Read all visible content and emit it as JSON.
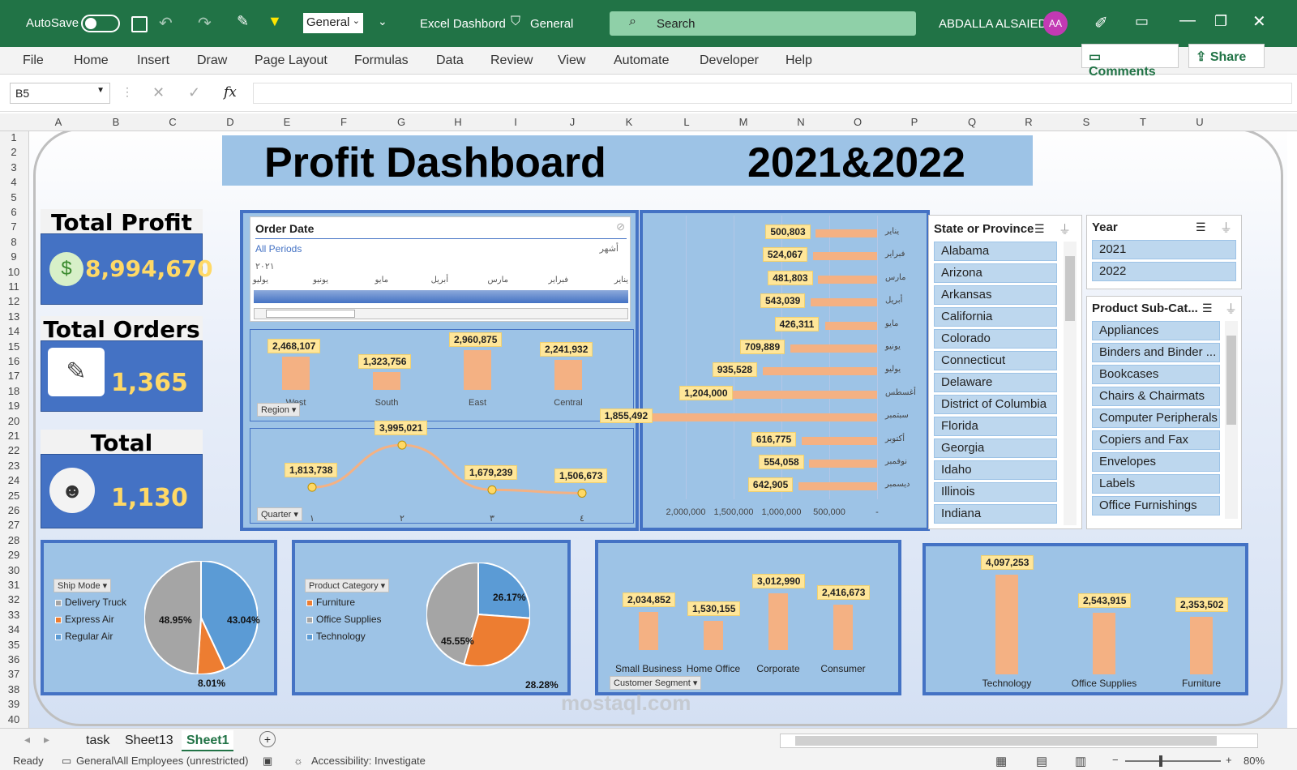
{
  "titlebar": {
    "autosave": "AutoSave",
    "format_value": "General",
    "doc_title": "Excel Dashbord",
    "sensitivity": "General",
    "search_placeholder": "Search",
    "user_name": "ABDALLA ALSAIED",
    "user_initials": "AA"
  },
  "ribbon": {
    "tabs": [
      "File",
      "Home",
      "Insert",
      "Draw",
      "Page Layout",
      "Formulas",
      "Data",
      "Review",
      "View",
      "Automate",
      "Developer",
      "Help"
    ],
    "comments": "Comments",
    "share": "Share"
  },
  "formula_bar": {
    "name_box": "B5",
    "fx": "fx"
  },
  "columns": [
    "A",
    "B",
    "C",
    "D",
    "E",
    "F",
    "G",
    "H",
    "I",
    "J",
    "K",
    "L",
    "M",
    "N",
    "O",
    "P",
    "Q",
    "R",
    "S",
    "T",
    "U"
  ],
  "rows": [
    "1",
    "2",
    "3",
    "4",
    "5",
    "6",
    "7",
    "8",
    "9",
    "10",
    "11",
    "12",
    "13",
    "14",
    "15",
    "16",
    "17",
    "18",
    "19",
    "20",
    "21",
    "22",
    "23",
    "24",
    "25",
    "26",
    "27",
    "28",
    "29",
    "30",
    "31",
    "32",
    "33",
    "34",
    "35",
    "36",
    "37",
    "38",
    "39",
    "40"
  ],
  "dashboard": {
    "title": "Profit Dashboard",
    "years": "2021&2022",
    "kpis": [
      {
        "title": "Total Profit",
        "value": "8,994,670",
        "icon": "money-bag-icon"
      },
      {
        "title": "Total Orders",
        "value": "1,365",
        "icon": "orders-icon"
      },
      {
        "title": "Total Customer",
        "value": "1,130",
        "icon": "customers-icon"
      }
    ],
    "timeline": {
      "title": "Order Date",
      "period": "All Periods",
      "unit": "أشهر",
      "year": "٢٠٢١",
      "months": [
        "يناير",
        "فبراير",
        "مارس",
        "أبريل",
        "مايو",
        "يونيو",
        "يوليو"
      ]
    },
    "state_slicer": {
      "title": "State or Province",
      "items": [
        "Alabama",
        "Arizona",
        "Arkansas",
        "California",
        "Colorado",
        "Connecticut",
        "Delaware",
        "District of Columbia",
        "Florida",
        "Georgia",
        "Idaho",
        "Illinois",
        "Indiana"
      ]
    },
    "year_slicer": {
      "title": "Year",
      "items": [
        "2021",
        "2022"
      ]
    },
    "subcat_slicer": {
      "title": "Product Sub-Cat...",
      "items": [
        "Appliances",
        "Binders and Binder ...",
        "Bookcases",
        "Chairs & Chairmats",
        "Computer Peripherals",
        "Copiers and Fax",
        "Envelopes",
        "Labels",
        "Office Furnishings"
      ]
    },
    "region_filter": "Region",
    "quarter_filter": "Quarter",
    "shipmode_filter": "Ship Mode",
    "category_filter": "Product Category",
    "segment_filter": "Customer Segment",
    "watermark": "mostaql.com"
  },
  "chart_data": [
    {
      "type": "bar",
      "id": "region",
      "categories": [
        "West",
        "South",
        "East",
        "Central"
      ],
      "values": [
        2468107,
        1323756,
        2960875,
        2241932
      ],
      "labels": [
        "2,468,107",
        "1,323,756",
        "2,960,875",
        "2,241,932"
      ]
    },
    {
      "type": "line",
      "id": "quarter",
      "x": [
        "1",
        "2",
        "3",
        "4"
      ],
      "values": [
        1813738,
        3995021,
        1679239,
        1506673
      ],
      "labels": [
        "1,813,738",
        "3,995,021",
        "1,679,239",
        "1,506,673"
      ],
      "x_labels": [
        "١",
        "٢",
        "٣",
        "٤"
      ]
    },
    {
      "type": "bar",
      "id": "month",
      "orientation": "horizontal",
      "categories": [
        "يناير",
        "فبراير",
        "مارس",
        "أبريل",
        "مايو",
        "يونيو",
        "يوليو",
        "أغسطس",
        "سبتمبر",
        "أكتوبر",
        "نوفمبر",
        "ديسمبر"
      ],
      "values": [
        500803,
        524067,
        481803,
        543039,
        426311,
        709889,
        935528,
        1204000,
        1855492,
        616775,
        554058,
        642905
      ],
      "labels": [
        "500,803",
        "524,067",
        "481,803",
        "543,039",
        "426,311",
        "709,889",
        "935,528",
        "1,204,000",
        "1,855,492",
        "616,775",
        "554,058",
        "642,905"
      ],
      "axis_ticks": [
        "2,000,000",
        "1,500,000",
        "1,000,000",
        "500,000",
        "-"
      ],
      "xlim": [
        0,
        2000000
      ]
    },
    {
      "type": "pie",
      "id": "shipmode",
      "categories": [
        "Delivery Truck",
        "Express Air",
        "Regular Air"
      ],
      "values": [
        48.95,
        8.01,
        43.04
      ],
      "labels": [
        "48.95%",
        "8.01%",
        "43.04%"
      ],
      "colors": [
        "#a5a5a5",
        "#ed7d31",
        "#5b9bd5"
      ]
    },
    {
      "type": "pie",
      "id": "category",
      "categories": [
        "Furniture",
        "Office Supplies",
        "Technology"
      ],
      "values": [
        28.28,
        45.55,
        26.17
      ],
      "labels": [
        "28.28%",
        "45.55%",
        "26.17%"
      ],
      "colors": [
        "#ed7d31",
        "#a5a5a5",
        "#5b9bd5"
      ]
    },
    {
      "type": "bar",
      "id": "segment",
      "categories": [
        "Small Business",
        "Home Office",
        "Corporate",
        "Consumer"
      ],
      "values": [
        2034852,
        1530155,
        3012990,
        2416673
      ],
      "labels": [
        "2,034,852",
        "1,530,155",
        "3,012,990",
        "2,416,673"
      ]
    },
    {
      "type": "bar",
      "id": "category_profit",
      "categories": [
        "Technology",
        "Office Supplies",
        "Furniture"
      ],
      "values": [
        4097253,
        2543915,
        2353502
      ],
      "labels": [
        "4,097,253",
        "2,543,915",
        "2,353,502"
      ]
    }
  ],
  "sheets": {
    "tabs": [
      "task",
      "Sheet13",
      "Sheet1"
    ],
    "active": "Sheet1"
  },
  "status": {
    "ready": "Ready",
    "sensitivity": "General\\All Employees (unrestricted)",
    "accessibility": "Accessibility: Investigate",
    "zoom": "80%"
  }
}
